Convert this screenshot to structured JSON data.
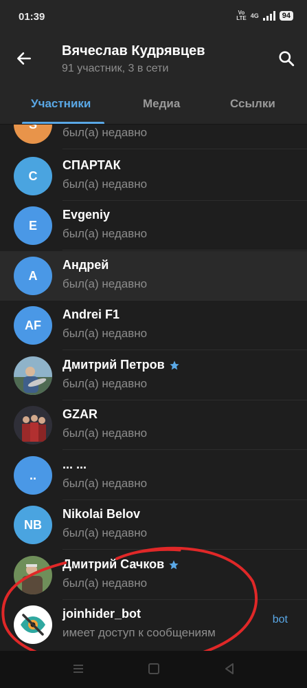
{
  "status_bar": {
    "time": "01:39",
    "volte_top": "Vo",
    "volte_bottom": "LTE",
    "network": "4G",
    "battery": "94"
  },
  "header": {
    "title": "Вячеслав Кудрявцев",
    "subtitle": "91 участник, 3 в сети",
    "back_icon": "arrow-left-icon",
    "search_icon": "search-icon"
  },
  "tabs": [
    {
      "label": "Участники",
      "active": true
    },
    {
      "label": "Медиа",
      "active": false
    },
    {
      "label": "Ссылки",
      "active": false
    }
  ],
  "members": [
    {
      "initials": "S",
      "name": "",
      "status": "был(а) недавно",
      "color": "#e8944a",
      "star": false
    },
    {
      "initials": "C",
      "name": "СПАРТАК",
      "status": "был(а) недавно",
      "color": "#4aa4e0",
      "star": false
    },
    {
      "initials": "E",
      "name": "Evgeniy",
      "status": "был(а) недавно",
      "color": "#4a98e6",
      "star": false
    },
    {
      "initials": "A",
      "name": "Андрей",
      "status": "был(а) недавно",
      "color": "#4a98e6",
      "star": false,
      "highlighted": true
    },
    {
      "initials": "AF",
      "name": "Andrei F1",
      "status": "был(а) недавно",
      "color": "#4a98e6",
      "star": false
    },
    {
      "initials": "",
      "name": "Дмитрий Петров",
      "status": "был(а) недавно",
      "photo": true,
      "star": true
    },
    {
      "initials": "",
      "name": "GZAR",
      "status": "был(а) недавно",
      "photo": true,
      "star": false
    },
    {
      "initials": "..",
      "name": "... ...",
      "status": "был(а) недавно",
      "color": "#4a98e6",
      "star": false
    },
    {
      "initials": "NB",
      "name": "Nikolai Belov",
      "status": "был(а) недавно",
      "color": "#4aa4e0",
      "star": false
    },
    {
      "initials": "",
      "name": "Дмитрий Сачков",
      "status": "был(а) недавно",
      "photo": true,
      "star": true
    },
    {
      "initials": "",
      "name": "joinhider_bot",
      "status": "имеет доступ к сообщениям",
      "bot": true,
      "badge": "bot",
      "star": false
    }
  ],
  "navbar": {
    "icons": [
      "menu-icon",
      "home-square-icon",
      "back-triangle-icon"
    ]
  },
  "colors": {
    "accent": "#5aa8e6",
    "background": "#1e1e1e",
    "header": "#262626",
    "annotation": "#e02828"
  }
}
